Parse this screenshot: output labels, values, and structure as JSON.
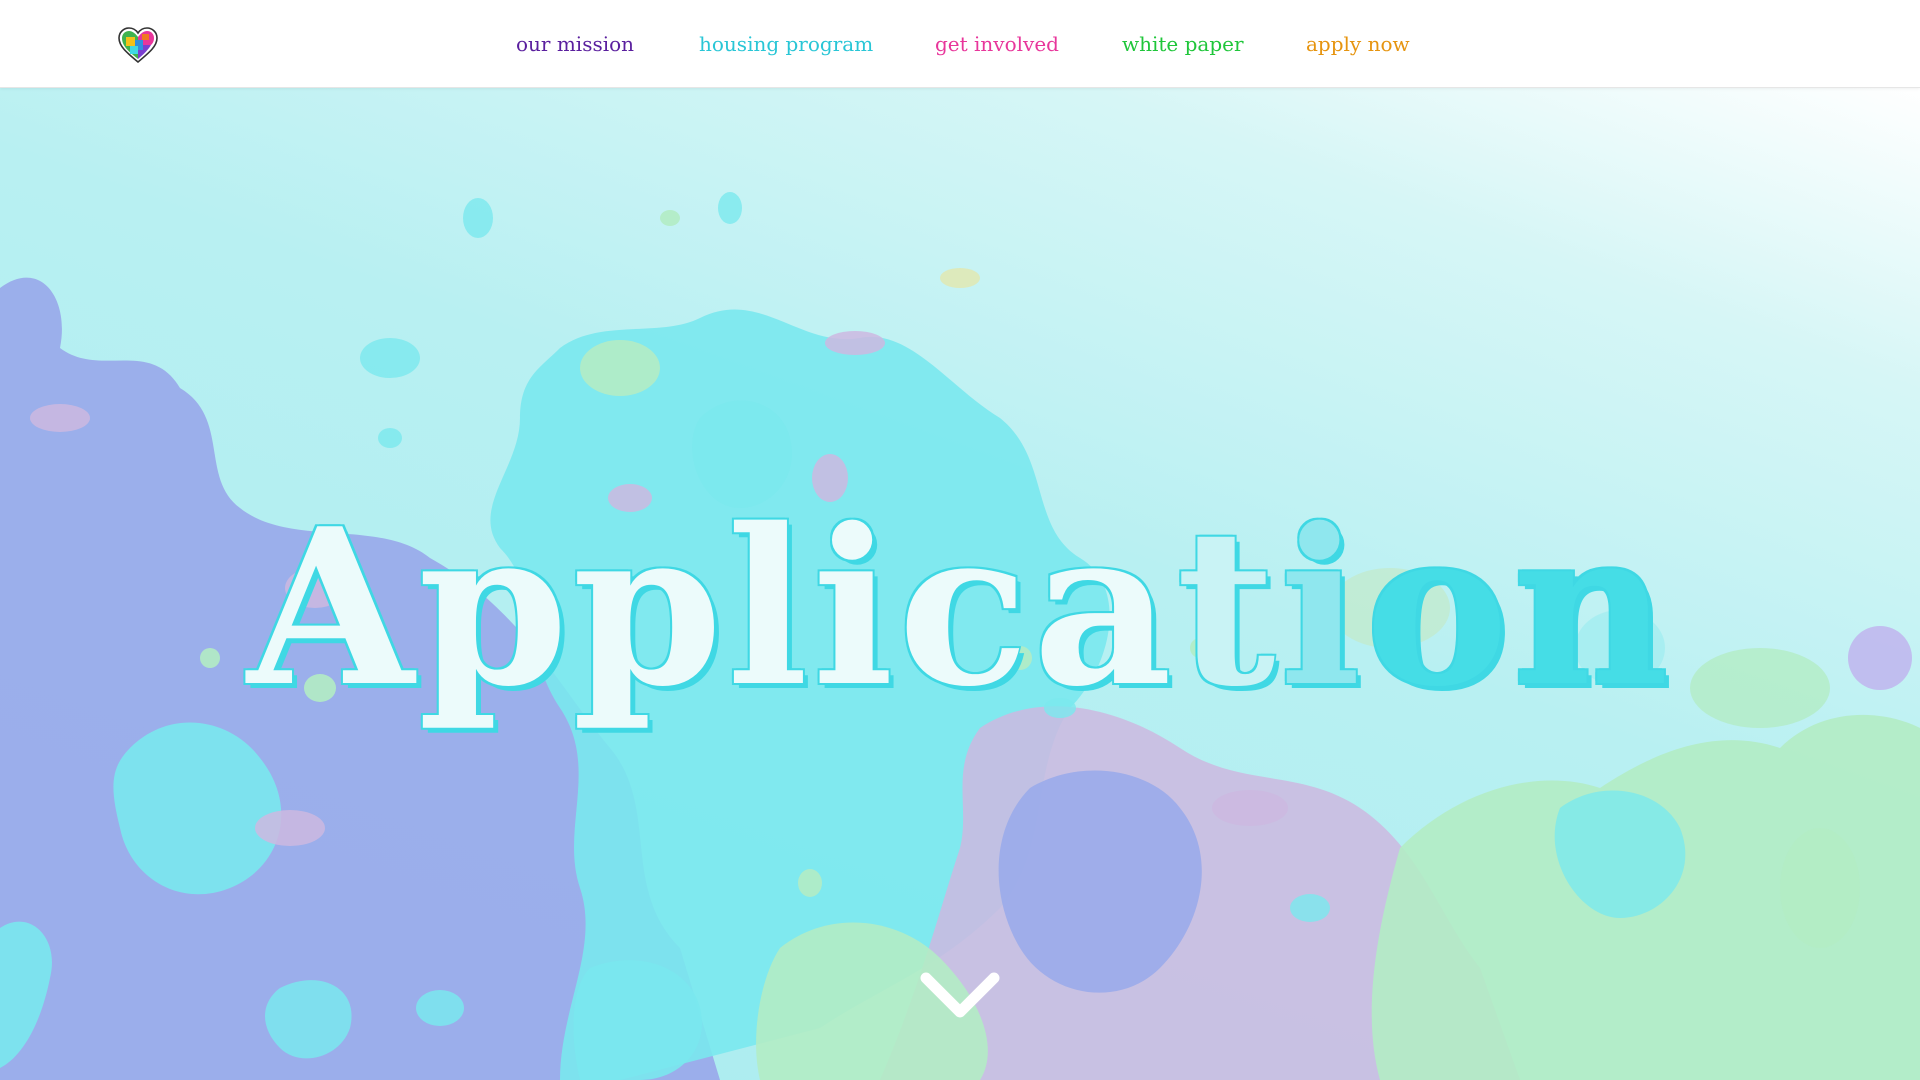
{
  "header": {
    "logo_icon": "multicolor-heart-icon",
    "nav": [
      {
        "label": "our mission",
        "color": "#5a1f9e"
      },
      {
        "label": "housing program",
        "color": "#29c6d6"
      },
      {
        "label": "get involved",
        "color": "#e8369b"
      },
      {
        "label": "white paper",
        "color": "#1fc63a"
      },
      {
        "label": "apply now",
        "color": "#e6940f"
      }
    ]
  },
  "hero": {
    "title_part1": "Applica",
    "title_part2": "t",
    "title_part3": "i",
    "title_part4": "on",
    "scroll_icon": "chevron-down-icon",
    "background_colors": [
      "#a9ecef",
      "#9aa8e8",
      "#b9e8c4",
      "#cdb8e0",
      "#7ae8ee"
    ]
  }
}
